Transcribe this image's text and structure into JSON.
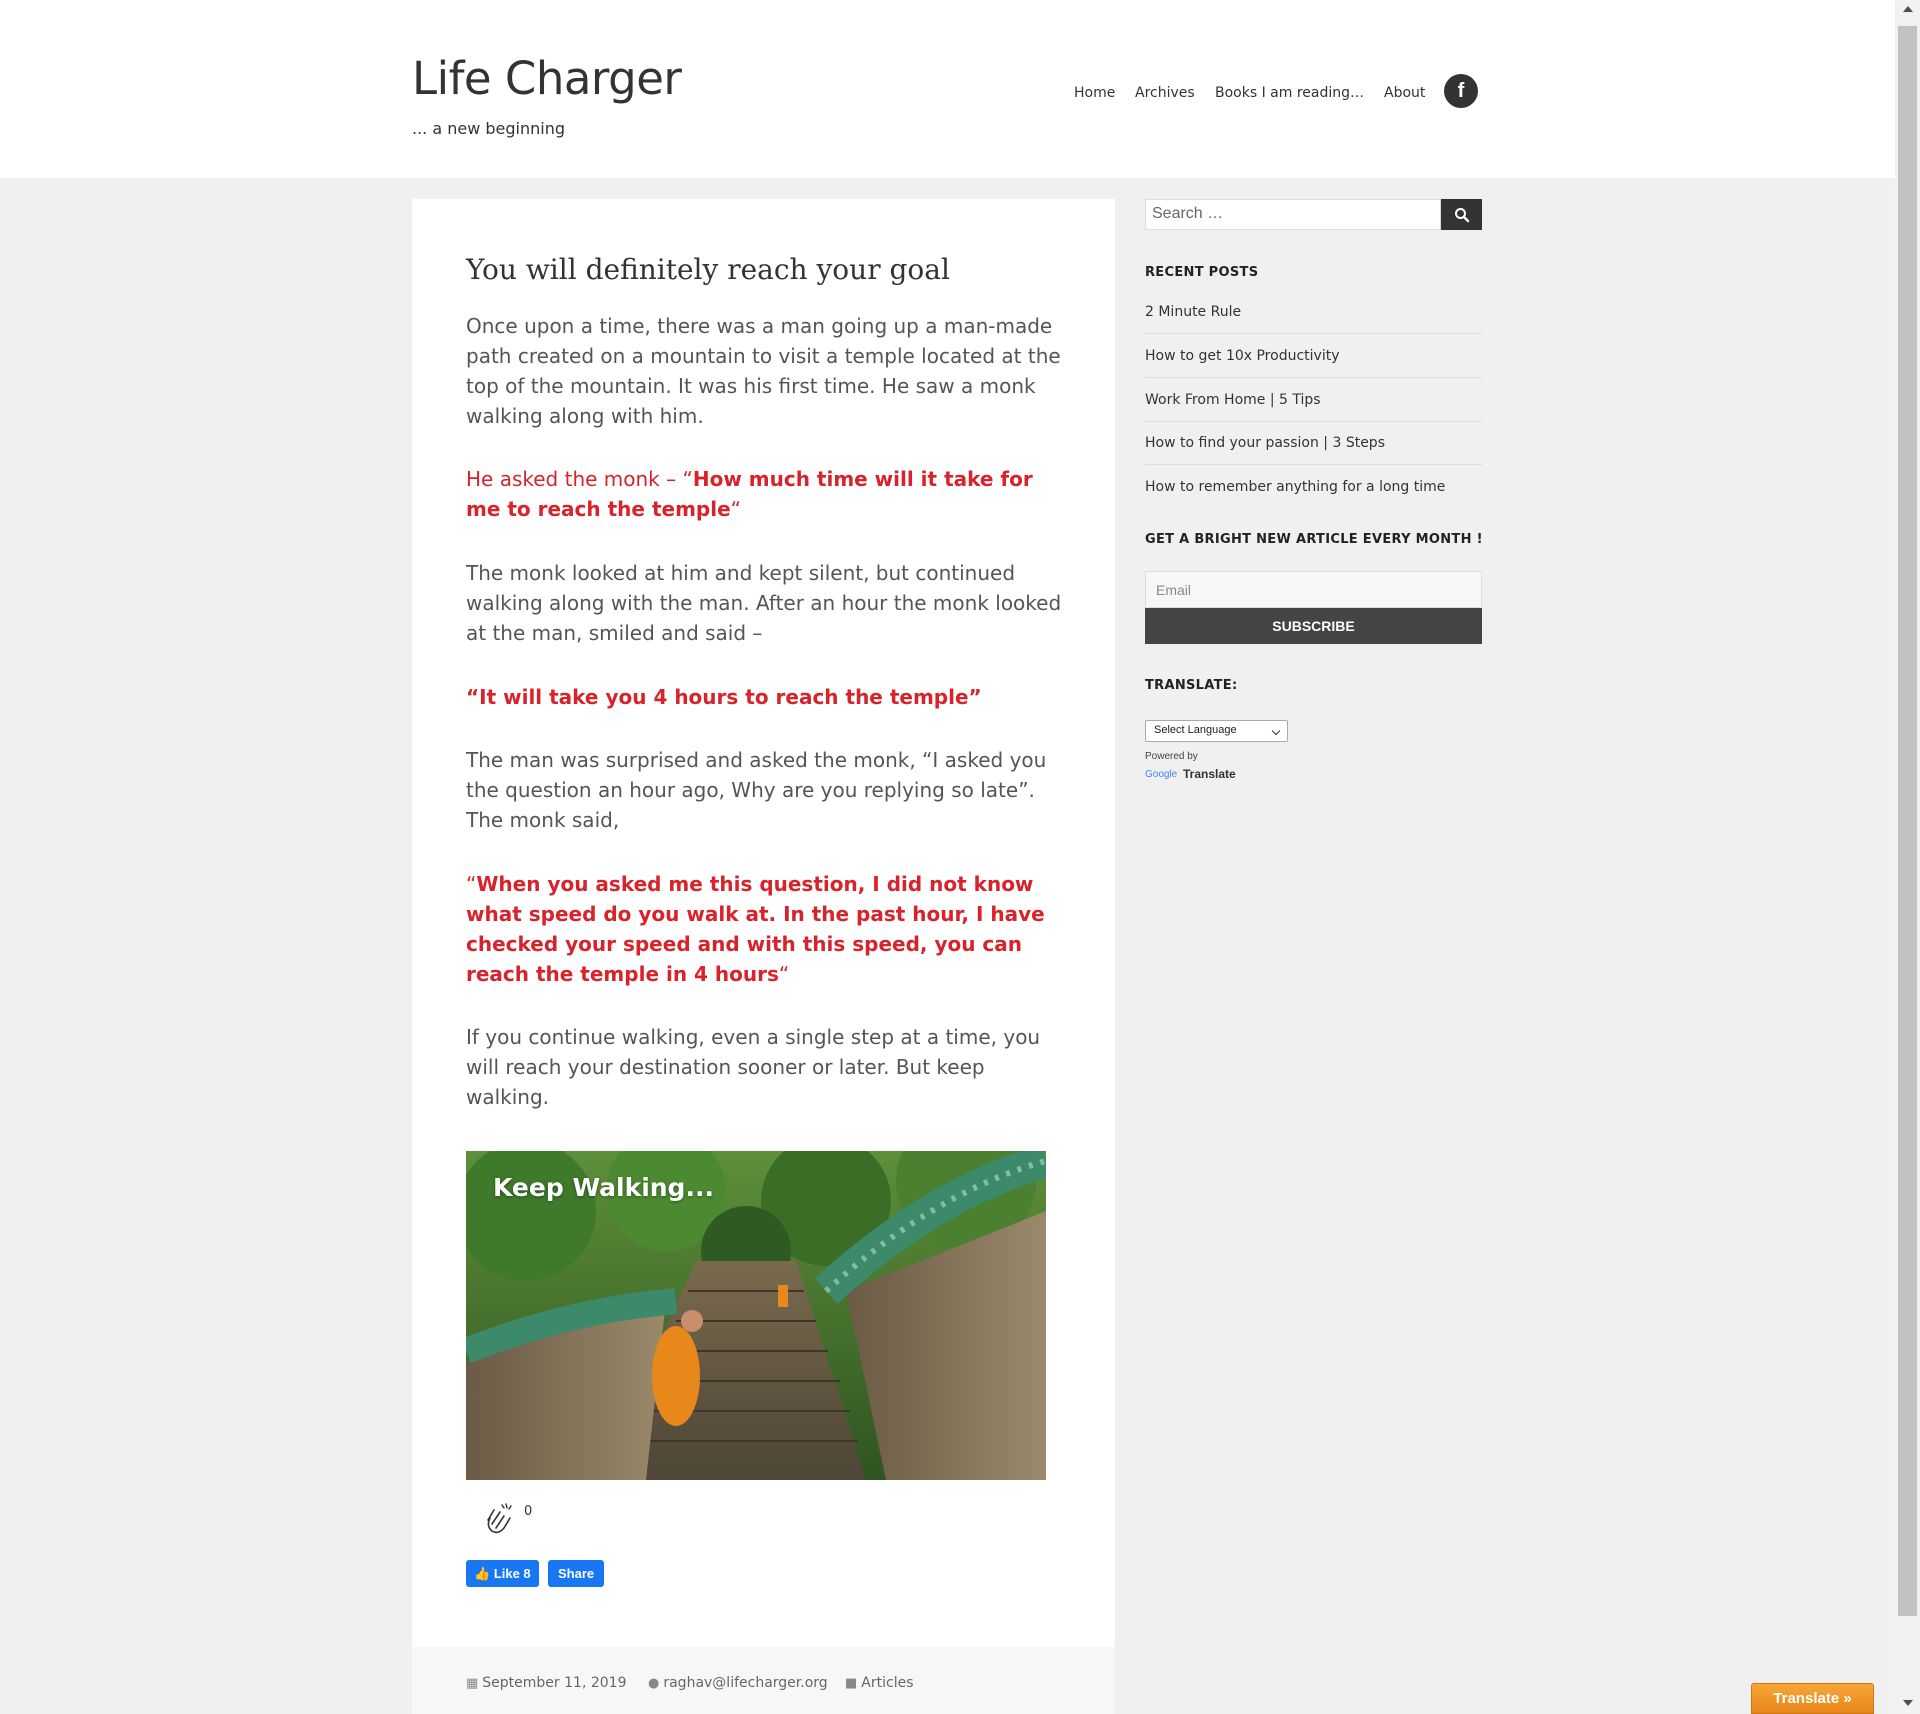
{
  "site": {
    "title": "Life Charger",
    "description": "... a new beginning"
  },
  "nav": {
    "items": [
      "Home",
      "Archives",
      "Books I am reading…",
      "About"
    ],
    "social_icon": "facebook-icon",
    "social_glyph": "f"
  },
  "post": {
    "title": "You will definitely reach your goal",
    "p1": "Once upon a time, there was a man going up a man-made path created on a mountain to visit a temple located at the top of the mountain. It was his first time. He saw a monk walking along with him.",
    "q1_prefix": "He asked the monk – “",
    "q1_bold": "How much time will it take for me to reach the temple",
    "q1_suffix": "“",
    "p2": "The monk looked at him and kept silent, but continued walking along with the man. After an hour the monk looked at the man, smiled and said –",
    "q2": "“It will take you 4 hours to reach the temple”",
    "p3": "The man was surprised and asked the monk, “I asked you the question an hour ago, Why are you replying so late”. The monk said,",
    "q3_prefix": "“",
    "q3_bold": "When you asked me this question, I did not know what speed do you walk at. In the past hour, I have checked your speed and with this speed, you can reach the temple in 4 hours",
    "q3_suffix": "“",
    "p4": "If you continue walking, even a single step at a time, you will reach your destination sooner or later. But keep walking.",
    "image_caption": "Keep Walking...",
    "clap_count": "0",
    "fb_like_label": "Like 8",
    "fb_share_label": "Share",
    "meta": {
      "date": "September 11, 2019",
      "author": "raghav@lifecharger.org",
      "category": "Articles"
    }
  },
  "sidebar": {
    "search_placeholder": "Search …",
    "recent_posts_title": "RECENT POSTS",
    "recent_posts": [
      "2 Minute Rule",
      "How to get 10x Productivity",
      "Work From Home | 5 Tips",
      "How to find your passion | 3 Steps",
      "How to remember anything for a long time"
    ],
    "newsletter_title": "GET A BRIGHT NEW ARTICLE EVERY MONTH !",
    "email_placeholder": "Email",
    "subscribe_label": "SUBSCRIBE",
    "translate_title": "TRANSLATE:",
    "select_language": "Select Language",
    "powered_by": "Powered by",
    "google_word": "Google",
    "translate_word": "Translate"
  },
  "translate_tab": "Translate »",
  "colors": {
    "accent_red": "#d8232a",
    "facebook_blue": "#1877f2",
    "translate_orange": "#f29a2e"
  }
}
